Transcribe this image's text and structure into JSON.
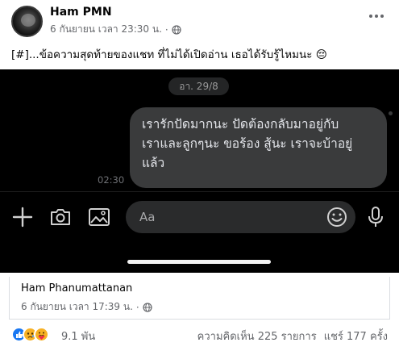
{
  "post": {
    "author": "Ham PMN",
    "timestamp": "6 กันยายน เวลา 23:30 น.",
    "separator": "·",
    "privacy_icon": "globe-icon",
    "more_icon": "more-horizontal-icon",
    "text": "[#]...ข้อความสุดท้ายของแชท ที่ไม่ได้เปิดอ่าน เธอได้รับรู้ไหมนะ 😔"
  },
  "chat": {
    "date_label": "อา. 29/8",
    "message_lines": [
      "เรารักปัดมากนะ ปัดต้องกลับมาอยู่กับ",
      "เราและลูกๆนะ ขอร้อง สู้นะ เราจะบ้าอยู่",
      "แล้ว"
    ],
    "message_time": "02:30",
    "input_placeholder": "Aa",
    "icons": [
      "plus-icon",
      "camera-icon",
      "photo-icon",
      "emoji-icon",
      "microphone-icon"
    ],
    "background_color": "#000000",
    "bubble_color": "#3a3b3c"
  },
  "shared": {
    "author": "Ham Phanumattanan",
    "timestamp": "6 กันยายน เวลา 17:39 น.",
    "separator": "·",
    "privacy_icon": "globe-icon"
  },
  "footer": {
    "reaction_icons": [
      "like-icon",
      "sad-icon",
      "care-icon"
    ],
    "reaction_count": "9.1 พัน",
    "comments": "ความคิดเห็น 225 รายการ",
    "shares": "แชร์ 177 ครั้ง"
  }
}
